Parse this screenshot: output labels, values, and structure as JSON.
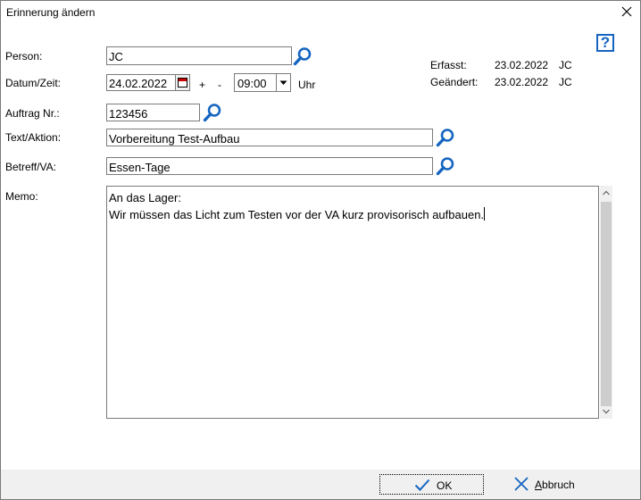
{
  "window": {
    "title": "Erinnerung ändern"
  },
  "form": {
    "person_label": "Person:",
    "person_value": "JC",
    "datetime_label": "Datum/Zeit:",
    "date_value": "24.02.2022",
    "plus": "+",
    "minus": "-",
    "time_value": "09:00",
    "time_unit": "Uhr",
    "order_label": "Auftrag Nr.:",
    "order_value": "123456",
    "text_label": "Text/Aktion:",
    "text_value": "Vorbereitung Test-Aufbau",
    "subject_label": "Betreff/VA:",
    "subject_value": "Essen-Tage",
    "memo_label": "Memo:",
    "memo_lines": [
      "An das Lager:",
      "Wir müssen das Licht zum Testen vor der VA kurz provisorisch aufbauen."
    ]
  },
  "info": {
    "captured_label": "Erfasst:",
    "captured_date": "23.02.2022",
    "captured_user": "JC",
    "changed_label": "Geändert:",
    "changed_date": "23.02.2022",
    "changed_user": "JC"
  },
  "help": {
    "glyph": "?"
  },
  "footer": {
    "ok_label": "OK",
    "cancel_prefix": "A",
    "cancel_rest": "bbruch"
  },
  "colors": {
    "accent": "#1565c0",
    "footer_bg": "#f0f0f0",
    "border": "#7a7a7a"
  }
}
